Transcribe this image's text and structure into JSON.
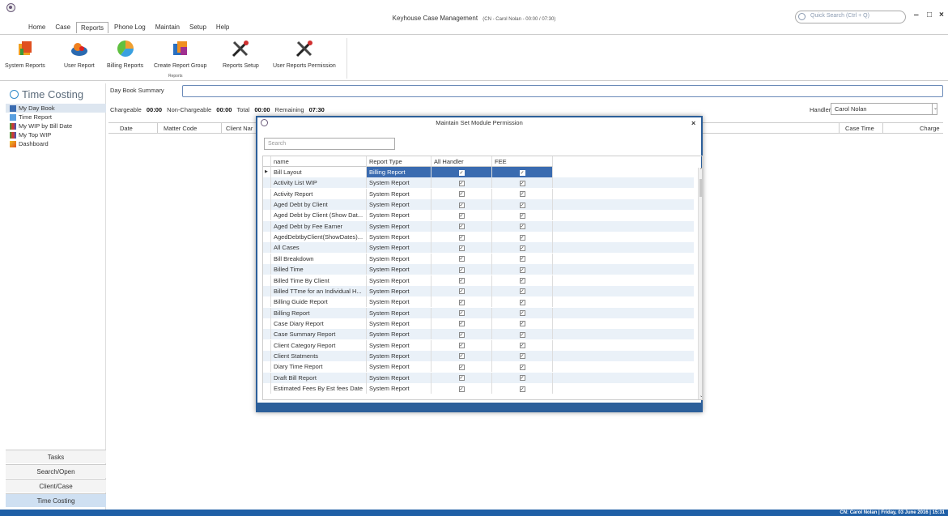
{
  "app": {
    "title": "Keyhouse Case Management",
    "subtitle": "(CN - Carol Nolan - 00:00 / 07:30)",
    "quick_search_placeholder": "Quick Search (Ctrl + Q)",
    "minimize": "‒",
    "maximize": "□",
    "close": "×"
  },
  "menu": [
    "Home",
    "Case",
    "Reports",
    "Phone Log",
    "Maintain",
    "Setup",
    "Help"
  ],
  "ribbon": {
    "buttons": [
      "System Reports",
      "User Report",
      "Billing Reports",
      "Create Report Group",
      "Reports Setup",
      "User Reports Permission"
    ],
    "group_label": "Reports"
  },
  "leftnav": {
    "title": "Time Costing",
    "items": [
      "My Day Book",
      "Time Report",
      "My WIP by Bill Date",
      "My Top WIP",
      "Dashboard"
    ],
    "bottom": [
      "Tasks",
      "Search/Open",
      "Client/Case",
      "Time Costing"
    ]
  },
  "main": {
    "day_book_label": "Day Book Summary",
    "chargeable_label": "Chargeable",
    "chargeable_value": "00:00",
    "nonchargeable_label": "Non-Chargeable",
    "nonchargeable_value": "00:00",
    "total_label": "Total",
    "total_value": "00:00",
    "remaining_label": "Remaining",
    "remaining_value": "07:30",
    "handler_label": "Handler",
    "handler_value": "Carol Nolan",
    "columns": [
      "Date",
      "Matter Code",
      "Client Nar",
      "Case Time",
      "Charge"
    ]
  },
  "dialog": {
    "title": "Maintain Set Module Permission",
    "search_placeholder": "Search",
    "columns": [
      "name",
      "Report Type",
      "All Handler",
      "FEE"
    ],
    "rows": [
      {
        "name": "Bill Layout",
        "type": "Billing Report"
      },
      {
        "name": "Activity List WIP",
        "type": "System Report"
      },
      {
        "name": "Activity Report",
        "type": "System Report"
      },
      {
        "name": "Aged Debt by Client",
        "type": "System Report"
      },
      {
        "name": "Aged Debt by Client (Show Dat...",
        "type": "System Report"
      },
      {
        "name": "Aged Debt by Fee Earner",
        "type": "System Report"
      },
      {
        "name": "AgedDebtbyClient(ShowDates)...",
        "type": "System Report"
      },
      {
        "name": "All Cases",
        "type": "System Report"
      },
      {
        "name": "Bill Breakdown",
        "type": "System Report"
      },
      {
        "name": "Billed Time",
        "type": "System Report"
      },
      {
        "name": "Billed Time By Client",
        "type": "System Report"
      },
      {
        "name": "Billed TTme for an Individual H...",
        "type": "System Report"
      },
      {
        "name": "Billing Guide Report",
        "type": "System Report"
      },
      {
        "name": "Billing Report",
        "type": "System Report"
      },
      {
        "name": "Case Diary Report",
        "type": "System Report"
      },
      {
        "name": "Case Summary Report",
        "type": "System Report"
      },
      {
        "name": "Client Category Report",
        "type": "System Report"
      },
      {
        "name": "Client Statments",
        "type": "System Report"
      },
      {
        "name": "Diary Time Report",
        "type": "System Report"
      },
      {
        "name": "Draft Bill Report",
        "type": "System Report"
      },
      {
        "name": "Estimated Fees By Est fees Date",
        "type": "System Report"
      }
    ]
  },
  "status": "CN: Carol Nolan | Friday, 03 June 2016 | 15:31"
}
